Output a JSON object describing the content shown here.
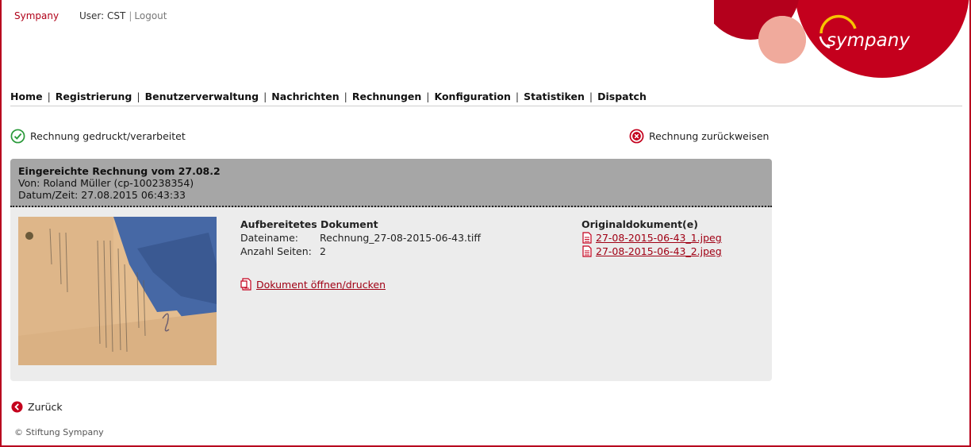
{
  "header": {
    "brand": "Sympany",
    "user_label": "User:",
    "user_name": "CST",
    "logout": "Logout",
    "logo_text": "sympany"
  },
  "nav": {
    "items": [
      "Home",
      "Registrierung",
      "Benutzerverwaltung",
      "Nachrichten",
      "Rechnungen",
      "Konfiguration",
      "Statistiken",
      "Dispatch"
    ]
  },
  "actions": {
    "processed": "Rechnung gedruckt/verarbeitet",
    "reject": "Rechnung zurückweisen"
  },
  "invoice": {
    "title": "Eingereichte Rechnung vom 27.08.2",
    "from": "Von: Roland Müller (cp-100238354)",
    "datetime": "Datum/Zeit: 27.08.2015 06:43:33",
    "processed_doc": {
      "heading": "Aufbereitetes Dokument",
      "filename_label": "Dateiname:",
      "filename": "Rechnung_27-08-2015-06-43.tiff",
      "pages_label": "Anzahl Seiten:",
      "pages": "2",
      "open_link": "Dokument öffnen/drucken"
    },
    "original_docs": {
      "heading": "Originaldokument(e)",
      "files": [
        "27-08-2015-06-43_1.jpeg",
        "27-08-2015-06-43_2.jpeg"
      ]
    }
  },
  "back_label": "Zurück",
  "footer": "© Stiftung Sympany",
  "colors": {
    "brand_red": "#c4001d",
    "link_red": "#a00014",
    "ok_green": "#2a9a3a",
    "header_gray": "#a6a6a6",
    "card_bg": "#ececec"
  },
  "icons": [
    "check-circle-icon",
    "reject-x-icon",
    "pdf-file-icon",
    "back-arrow-icon"
  ]
}
